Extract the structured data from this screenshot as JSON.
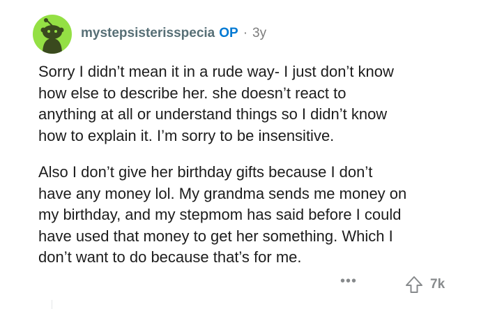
{
  "comment": {
    "username": "mystepsisterisspecia",
    "op_badge": "OP",
    "separator": "·",
    "age": "3y",
    "avatar_icon": "snoo-avatar-icon",
    "avatar_color": "#94e044",
    "paragraphs": [
      "Sorry I didn’t mean it in a rude way- I just don’t know\nhow else to describe her. she doesn’t react  to\nanything at all or understand things so I didn’t know\nhow to explain it. I’m sorry to be insensitive.",
      "Also I don’t give her birthday gifts because I don’t\nhave any money lol. My grandma sends me money on\nmy birthday, and my stepmom has said before I could\nhave used that money to get her something. Which I\ndon’t want to do because that’s for me."
    ],
    "actions": {
      "more_label": "•••",
      "upvote_icon": "upvote-arrow-icon",
      "score": "7k"
    }
  }
}
